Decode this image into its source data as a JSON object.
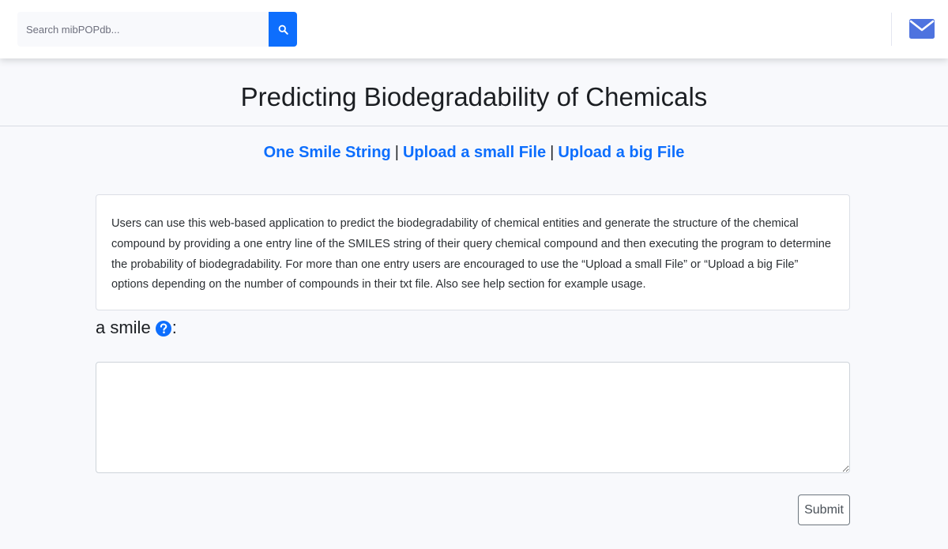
{
  "header": {
    "search": {
      "placeholder": "Search mibPOPdb...",
      "value": "",
      "button_icon": "search-icon"
    },
    "mail_icon": "envelope-icon"
  },
  "page": {
    "title": "Predicting Biodegradability of Chemicals"
  },
  "mode_nav": {
    "items": [
      {
        "label": "One Smile String"
      },
      {
        "label": "Upload a small File"
      },
      {
        "label": "Upload a big File"
      }
    ],
    "separator": "|"
  },
  "info": {
    "text": "Users can use this web-based application to predict the biodegradability of chemical entities and generate the structure of the chemical compound by providing a one entry line of the SMILES string of their query chemical compound and then executing the program to determine the probability of biodegradability. For more than one entry users are encouraged to use the “Upload a small File” or “Upload a big File” options depending on the number of compounds in their txt file. Also see help section for example usage."
  },
  "form": {
    "label": "a smile",
    "label_suffix": ":",
    "help_icon": "question-circle-icon",
    "textarea_value": "",
    "submit_label": "Submit"
  },
  "colors": {
    "accent": "#0d6efd",
    "mail_icon": "#4e73df",
    "background": "#f8f9fc"
  }
}
